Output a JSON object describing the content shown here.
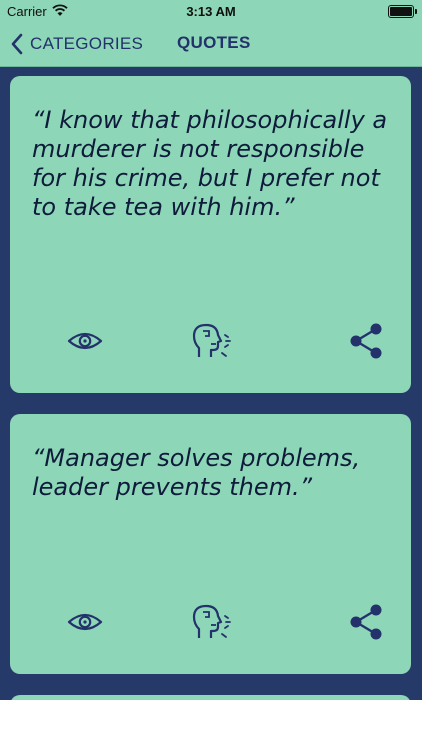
{
  "status_bar": {
    "carrier": "Carrier",
    "time": "3:13 AM"
  },
  "nav": {
    "back_label": "CATEGORIES",
    "title": "QUOTES"
  },
  "quotes": [
    {
      "text": "“I know that philosophically a murderer is not responsible for his crime, but I prefer not to take tea with him.”"
    },
    {
      "text": "“Manager solves problems, leader prevents them.”"
    }
  ],
  "icons": {
    "eye": "eye-icon",
    "speak": "speak-icon",
    "share": "share-icon",
    "back": "chevron-left-icon"
  },
  "colors": {
    "bar_background": "#8ed6b8",
    "card_background": "#8ed6b8",
    "page_background": "#263a69",
    "accent": "#23326b",
    "quote_text": "#0f1b3a"
  }
}
